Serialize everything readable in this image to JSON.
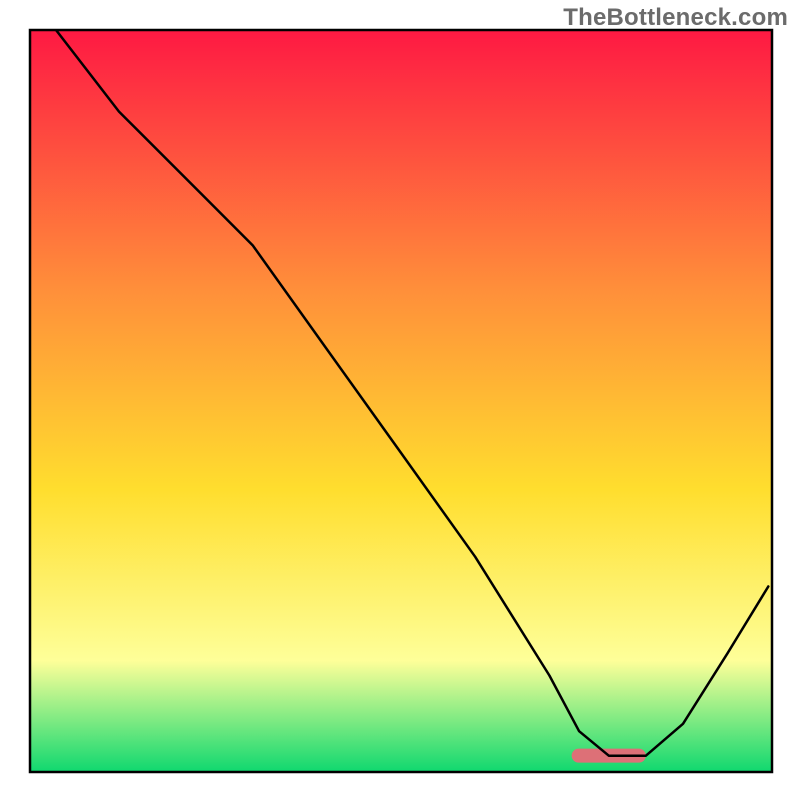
{
  "watermark": "TheBottleneck.com",
  "chart_data": {
    "type": "line",
    "title": "",
    "xlabel": "",
    "ylabel": "",
    "xlim": [
      0,
      100
    ],
    "ylim": [
      0,
      100
    ],
    "grid": false,
    "legend": false,
    "background_gradient": {
      "top": "#fe1943",
      "upper_mid": "#ff8f3a",
      "mid": "#ffde2e",
      "lower_mid": "#feff99",
      "bottom": "#0fd86f"
    },
    "highlight_bar": {
      "x_start": 73,
      "x_end": 83,
      "y": 2.2,
      "color": "#dd7077"
    },
    "series": [
      {
        "name": "bottleneck-curve",
        "x": [
          3.5,
          12,
          23,
          30,
          40,
          50,
          60,
          70,
          74,
          78,
          83,
          88,
          94,
          99.5
        ],
        "y": [
          100,
          89,
          78,
          71,
          57,
          43,
          29,
          13,
          5.5,
          2.2,
          2.2,
          6.5,
          16,
          25
        ]
      }
    ]
  }
}
